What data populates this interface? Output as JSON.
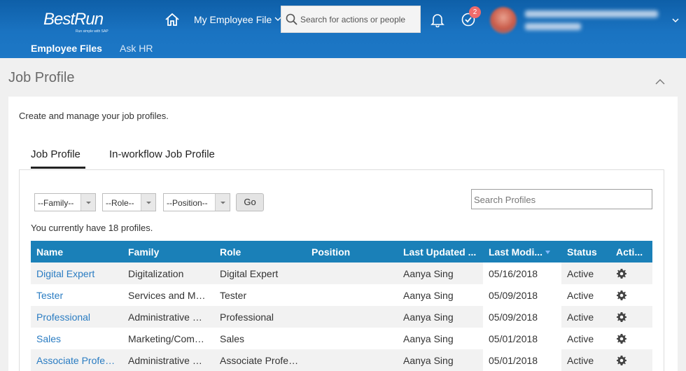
{
  "header": {
    "logo_text": "BestRun",
    "logo_tagline": "Run simple with SAP",
    "module": "My Employee File",
    "search_placeholder": "Search for actions or people",
    "notification_badge": "2",
    "subnav": [
      {
        "label": "Employee Files",
        "active": true
      },
      {
        "label": "Ask HR",
        "active": false
      }
    ]
  },
  "page": {
    "title": "Job Profile",
    "description": "Create and manage your job profiles.",
    "tabs": [
      {
        "label": "Job Profile",
        "active": true
      },
      {
        "label": "In-workflow Job Profile",
        "active": false
      }
    ]
  },
  "filters": {
    "family": "--Family--",
    "role": "--Role--",
    "position": "--Position--",
    "go_label": "Go",
    "search_placeholder": "Search Profiles"
  },
  "count_text": "You currently have 18 profiles.",
  "table": {
    "columns": [
      "Name",
      "Family",
      "Role",
      "Position",
      "Last Updated ...",
      "Last Modi...",
      "Status",
      "Acti..."
    ],
    "rows": [
      {
        "name": "Digital Expert",
        "family": "Digitalization",
        "role": "Digital Expert",
        "position": "",
        "updated_by": "Aanya Sing",
        "modified": "05/16/2018",
        "status": "Active"
      },
      {
        "name": "Tester",
        "family": "Services and Mai...",
        "role": "Tester",
        "position": "",
        "updated_by": "Aanya Sing",
        "modified": "05/09/2018",
        "status": "Active"
      },
      {
        "name": "Professional",
        "family": "Administrative Su...",
        "role": "Professional",
        "position": "",
        "updated_by": "Aanya Sing",
        "modified": "05/09/2018",
        "status": "Active"
      },
      {
        "name": "Sales",
        "family": "Marketing/Comm...",
        "role": "Sales",
        "position": "",
        "updated_by": "Aanya Sing",
        "modified": "05/01/2018",
        "status": "Active"
      },
      {
        "name": "Associate Profess...",
        "family": "Administrative Su...",
        "role": "Associate Profess...",
        "position": "",
        "updated_by": "Aanya Sing",
        "modified": "05/01/2018",
        "status": "Active"
      }
    ]
  },
  "colors": {
    "header": "#1a73c1",
    "table_header": "#1a80b8",
    "link": "#2a7cc2",
    "badge": "#ef6b6b"
  },
  "icons": [
    "home-icon",
    "search-icon",
    "bell-icon",
    "todo-check-icon",
    "gear-icon",
    "chevron-down-icon",
    "chevron-up-icon",
    "sort-desc-icon"
  ]
}
